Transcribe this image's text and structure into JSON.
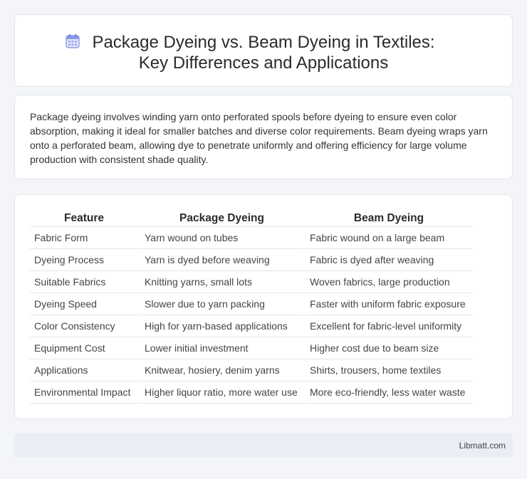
{
  "header": {
    "icon": "calendar-icon",
    "title": "Package Dyeing vs. Beam Dyeing in Textiles: Key Differences and Applications"
  },
  "intro": "Package dyeing involves winding yarn onto perforated spools before dyeing to ensure even color absorption, making it ideal for smaller batches and diverse color requirements. Beam dyeing wraps yarn onto a perforated beam, allowing dye to penetrate uniformly and offering efficiency for large volume production with consistent shade quality.",
  "table": {
    "headers": [
      "Feature",
      "Package Dyeing",
      "Beam Dyeing"
    ],
    "rows": [
      [
        "Fabric Form",
        "Yarn wound on tubes",
        "Fabric wound on a large beam"
      ],
      [
        "Dyeing Process",
        "Yarn is dyed before weaving",
        "Fabric is dyed after weaving"
      ],
      [
        "Suitable Fabrics",
        "Knitting yarns, small lots",
        "Woven fabrics, large production"
      ],
      [
        "Dyeing Speed",
        "Slower due to yarn packing",
        "Faster with uniform fabric exposure"
      ],
      [
        "Color Consistency",
        "High for yarn-based applications",
        "Excellent for fabric-level uniformity"
      ],
      [
        "Equipment Cost",
        "Lower initial investment",
        "Higher cost due to beam size"
      ],
      [
        "Applications",
        "Knitwear, hosiery, denim yarns",
        "Shirts, trousers, home textiles"
      ],
      [
        "Environmental Impact",
        "Higher liquor ratio, more water use",
        "More eco-friendly, less water waste"
      ]
    ]
  },
  "footer": {
    "brand": "Libmatt.com"
  },
  "colors": {
    "background": "#f3f5f9",
    "card": "#ffffff",
    "footer": "#e8edf6",
    "icon_accent": "#7b8fe0"
  }
}
